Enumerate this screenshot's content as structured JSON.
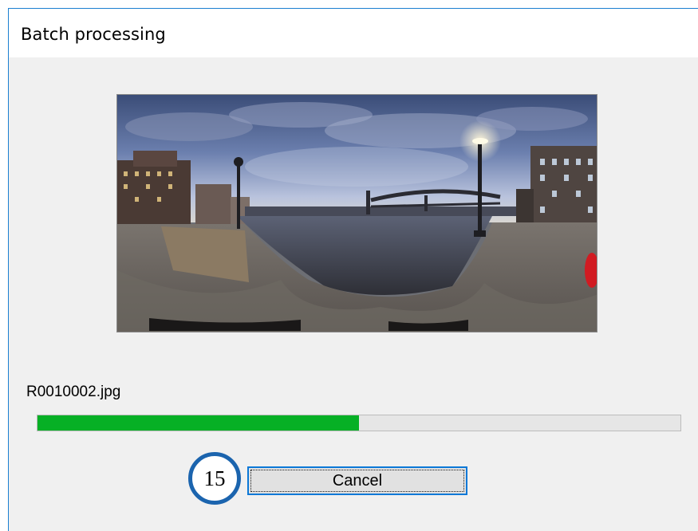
{
  "window": {
    "title": "Batch processing"
  },
  "preview": {
    "description_icon": "panorama-image"
  },
  "status": {
    "filename": "R0010002.jpg",
    "progress": 0.5
  },
  "annotation": {
    "step_number": "15"
  },
  "actions": {
    "cancel_label": "Cancel"
  },
  "colors": {
    "progress_fill": "#06b025",
    "focus_border": "#0b78d7",
    "annotation_ring": "#1b64ae"
  }
}
